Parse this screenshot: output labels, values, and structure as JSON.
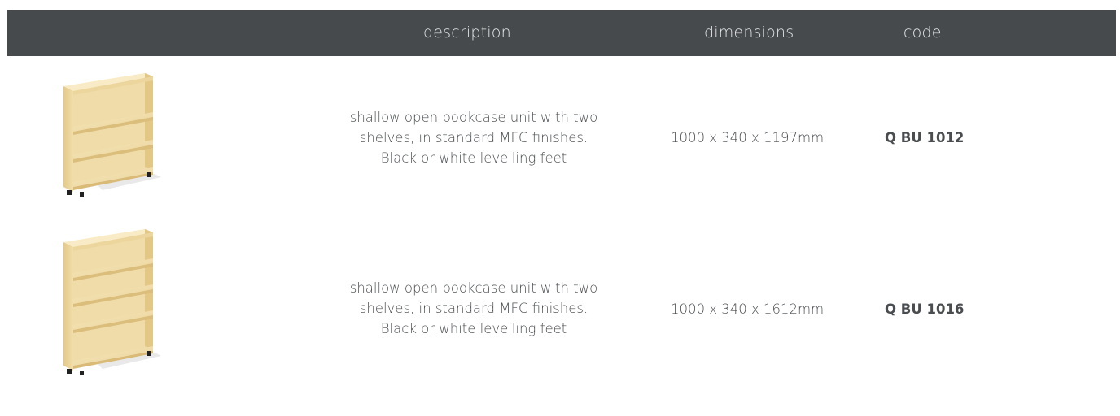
{
  "header": {
    "description": "description",
    "dimensions": "dimensions",
    "code": "code"
  },
  "products": [
    {
      "image": "shallow-bookcase-2-shelf-icon",
      "description_lines": [
        "shallow open bookcase unit with two",
        "shelves, in standard MFC finishes.",
        "Black or white levelling feet"
      ],
      "dimensions": "1000 x 340 x 1197mm",
      "code": "Q BU 1012"
    },
    {
      "image": "shallow-bookcase-4-shelf-icon",
      "description_lines": [
        "shallow open bookcase unit with two",
        "shelves, in standard MFC finishes.",
        "Black or white levelling feet"
      ],
      "dimensions": "1000 x 340 x 1612mm",
      "code": "Q BU 1016"
    }
  ],
  "colors": {
    "header_bg": "#464a4d",
    "header_text": "#e6e7e8",
    "body_text": "#4a4d50",
    "wood_light": "#f3e2b4",
    "wood_mid": "#e7cf95"
  }
}
